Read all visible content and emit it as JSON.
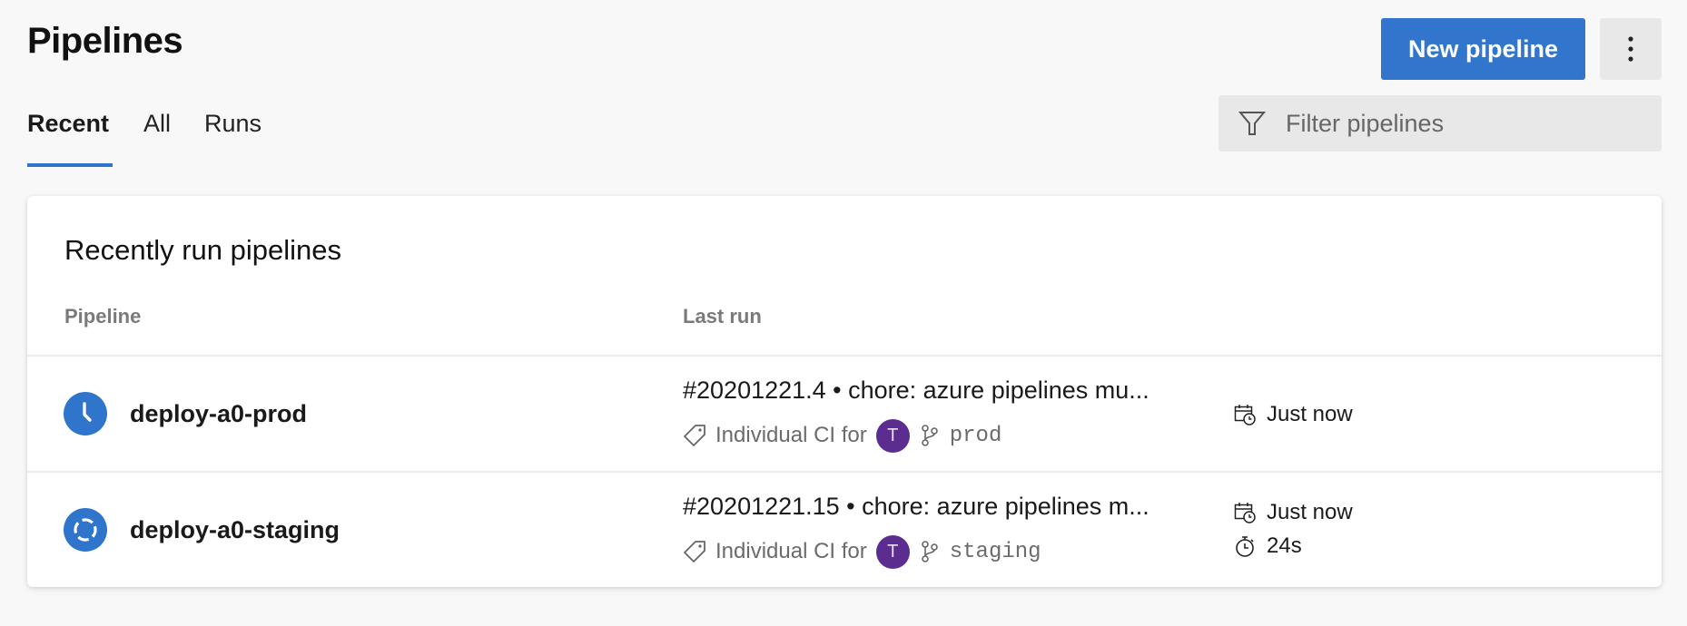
{
  "header": {
    "title": "Pipelines",
    "new_pipeline_label": "New pipeline",
    "more_icon": "more-vertical-icon"
  },
  "tabs": [
    {
      "label": "Recent",
      "active": true
    },
    {
      "label": "All",
      "active": false
    },
    {
      "label": "Runs",
      "active": false
    }
  ],
  "filter": {
    "placeholder": "Filter pipelines",
    "value": "",
    "icon": "filter-funnel-icon"
  },
  "card": {
    "title": "Recently run pipelines",
    "columns": [
      "Pipeline",
      "Last run"
    ],
    "rows": [
      {
        "name": "deploy-a0-prod",
        "status": "queued",
        "status_icon": "clock-icon",
        "run_title": "#20201221.4 • chore: azure pipelines mu...",
        "trigger": "Individual CI for",
        "avatar_initial": "T",
        "branch": "prod",
        "time": "Just now",
        "duration": null
      },
      {
        "name": "deploy-a0-staging",
        "status": "in-progress",
        "status_icon": "in-progress-ring-icon",
        "run_title": "#20201221.15 • chore: azure pipelines m...",
        "trigger": "Individual CI for",
        "avatar_initial": "T",
        "branch": "staging",
        "time": "Just now",
        "duration": "24s"
      }
    ]
  },
  "colors": {
    "accent": "#3176cc",
    "status_blue": "#2f75cc",
    "avatar_purple": "#5c2d91",
    "background": "#f8f8f8"
  }
}
